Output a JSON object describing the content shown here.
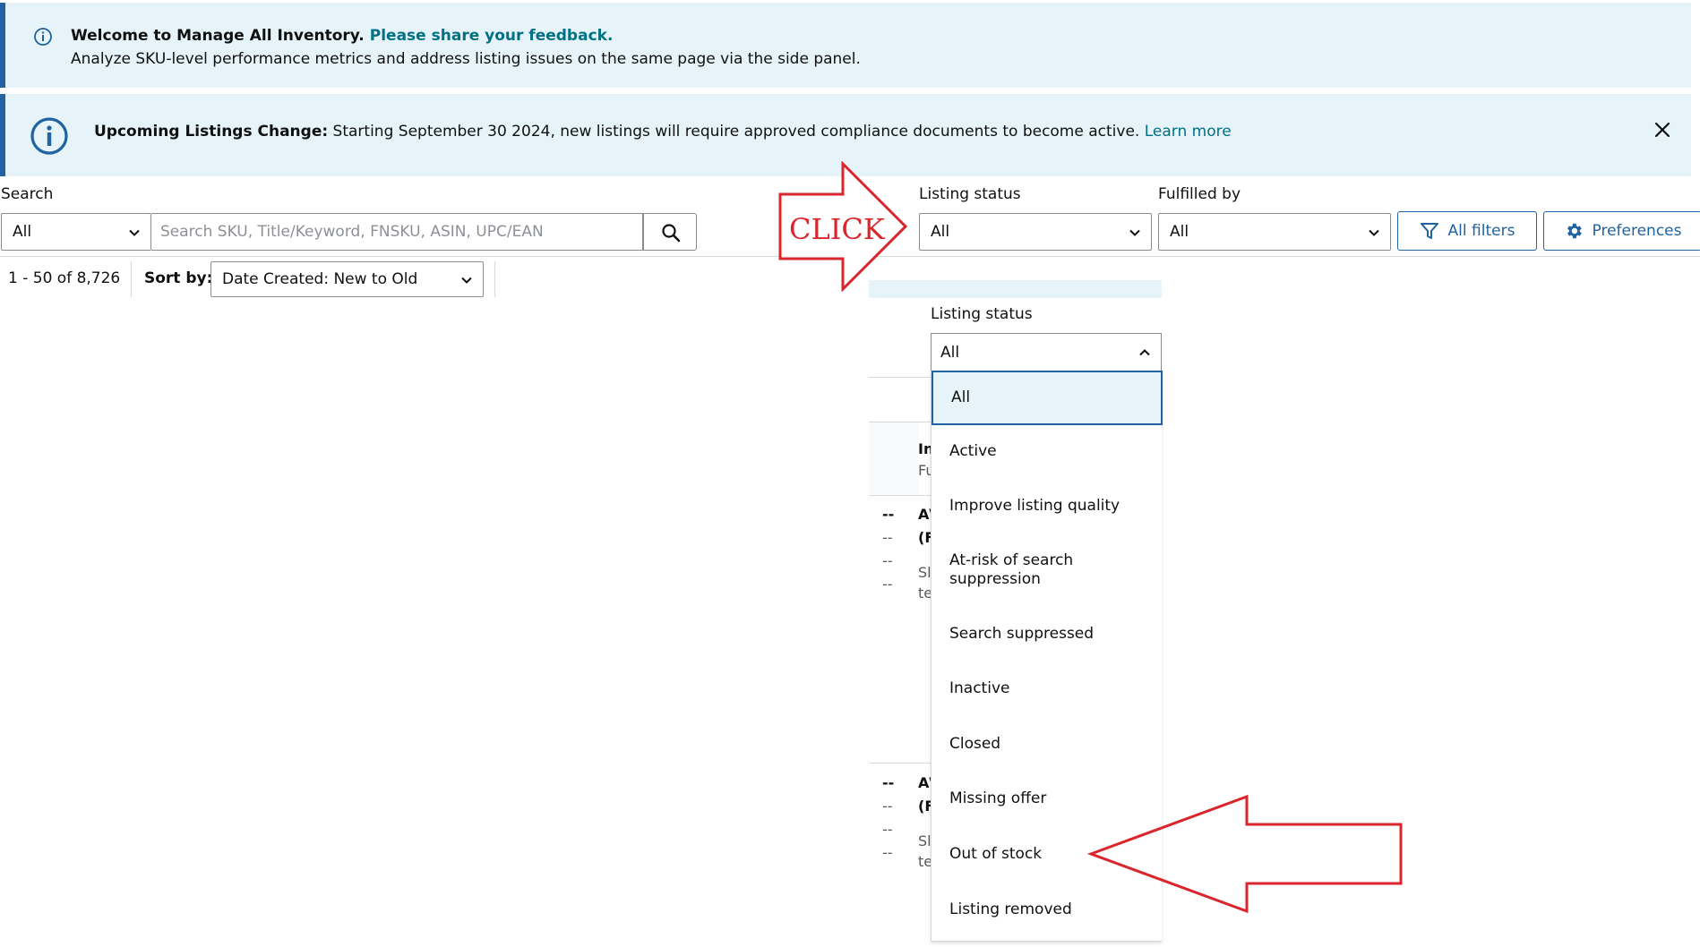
{
  "banner_welcome": {
    "title": "Welcome to Manage All Inventory.",
    "link": "Please share your feedback.",
    "body": "Analyze SKU-level performance metrics and address listing issues on the same page via the side panel."
  },
  "banner_change": {
    "heading": "Upcoming Listings Change:",
    "message": " Starting September 30 2024, new listings will require approved compliance documents to become active. ",
    "link": "Learn more"
  },
  "search": {
    "label": "Search",
    "scope_value": "All",
    "placeholder": "Search SKU, Title/Keyword, FNSKU, ASIN, UPC/EAN"
  },
  "filters": {
    "listing_status_label": "Listing status",
    "listing_status_value": "All",
    "fulfilled_by_label": "Fulfilled by",
    "fulfilled_by_value": "All",
    "all_filters": "All filters",
    "preferences": "Preferences"
  },
  "results": {
    "count": "1 - 50 of 8,726",
    "sort_label": "Sort by:",
    "sort_value": "Date Created: New to Old"
  },
  "dropdown": {
    "label": "Listing status",
    "value": "All",
    "options": [
      "All",
      "Active",
      "Improve listing quality",
      "At-risk of search suppression",
      "Search suppressed",
      "Inactive",
      "Closed",
      "Missing offer",
      "Out of stock",
      "Listing removed"
    ]
  },
  "background_table": {
    "dash": "--",
    "header_a": "In",
    "header_b": "Fu",
    "row_a": "A\\",
    "row_b": "(F",
    "row_c": "Sl",
    "row_d": "te"
  },
  "annotation": {
    "click_text": "CLICK",
    "color": "#d9252b"
  },
  "colors": {
    "banner_bg": "#e6f4fa",
    "accent": "#2162a1",
    "link": "#007185"
  }
}
